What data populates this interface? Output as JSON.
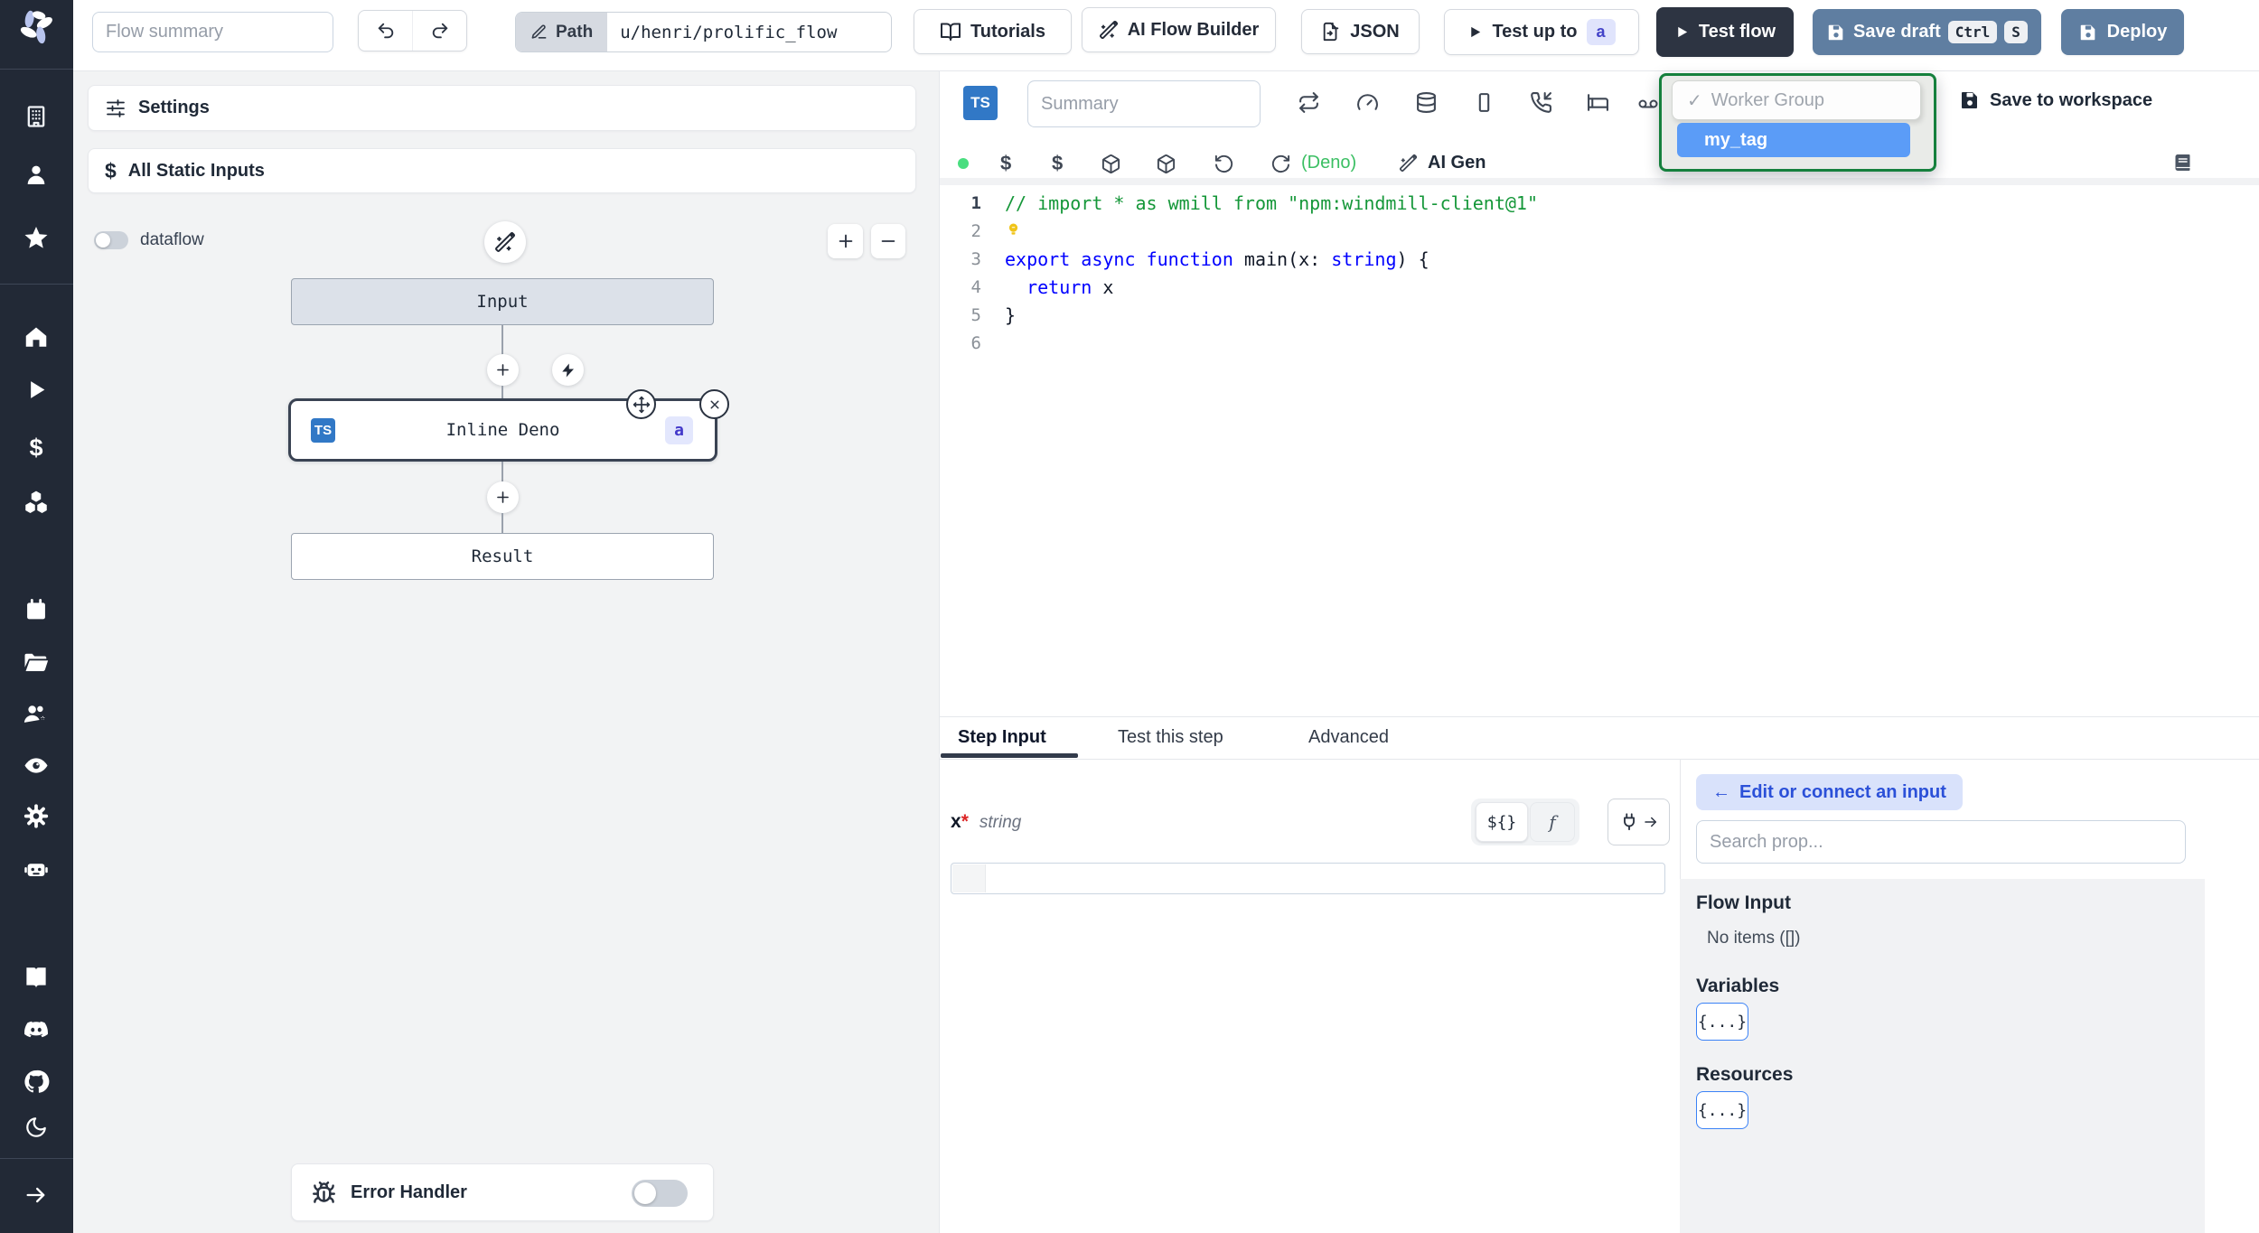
{
  "colors": {
    "sidebar_bg": "#222936",
    "dark_button": "#2d3442",
    "slate_button": "#5f7ea1",
    "ts_badge_blue": "#3178c6",
    "dropdown_outline_green": "#15803d",
    "dropdown_selected_blue": "#5b9cf7",
    "badge_indigo_bg": "#e0e4fc",
    "badge_indigo_text": "#4343c8",
    "status_green": "#4ade80"
  },
  "topbar": {
    "flow_summary_placeholder": "Flow summary",
    "path_button": "Path",
    "path_value": "u/henri/prolific_flow",
    "tutorials": "Tutorials",
    "ai_flow_builder": "AI Flow Builder",
    "json": "JSON",
    "test_up_to": "Test up to",
    "test_up_to_badge": "a",
    "test_flow": "Test flow",
    "save_draft": "Save draft",
    "kbd_ctrl": "Ctrl",
    "kbd_s": "S",
    "deploy": "Deploy"
  },
  "left_panel": {
    "settings": "Settings",
    "all_static_inputs": "All Static Inputs",
    "dataflow": "dataflow",
    "nodes": {
      "input": "Input",
      "step": "Inline Deno",
      "step_lang": "TS",
      "step_id": "a",
      "result": "Result"
    },
    "error_handler": "Error Handler"
  },
  "editor": {
    "lang_badge": "TS",
    "summary_placeholder": "Summary",
    "worker_group": {
      "checkmark": "✓",
      "label": "Worker Group",
      "selected": "my_tag"
    },
    "save_to_workspace": "Save to workspace",
    "runtime": "(Deno)",
    "ai_gen": "AI Gen",
    "code": {
      "lines": [
        {
          "n": "1",
          "segs": [
            {
              "t": "// import * as wmill from \"npm:windmill-client@1\"",
              "c": "cmt"
            }
          ]
        },
        {
          "n": "2",
          "bulb": true,
          "segs": []
        },
        {
          "n": "3",
          "segs": [
            {
              "t": "export",
              "c": "kw"
            },
            {
              "t": " ",
              "c": "pl"
            },
            {
              "t": "async",
              "c": "kw"
            },
            {
              "t": " ",
              "c": "pl"
            },
            {
              "t": "function",
              "c": "kw"
            },
            {
              "t": " main(x: ",
              "c": "pl"
            },
            {
              "t": "string",
              "c": "kw"
            },
            {
              "t": ") {",
              "c": "pl"
            }
          ]
        },
        {
          "n": "4",
          "segs": [
            {
              "t": "  ",
              "c": "pl"
            },
            {
              "t": "return",
              "c": "kw"
            },
            {
              "t": " x",
              "c": "pl"
            }
          ]
        },
        {
          "n": "5",
          "segs": [
            {
              "t": "}",
              "c": "pl"
            }
          ]
        },
        {
          "n": "6",
          "segs": []
        }
      ]
    }
  },
  "bottom": {
    "tabs": [
      "Step Input",
      "Test this step",
      "Advanced"
    ],
    "field": {
      "name": "x",
      "required": "*",
      "type": "string"
    },
    "toggle_expr": "${}",
    "toggle_fn": "f",
    "prop_picker": {
      "back_arrow": "←",
      "edit_connect": "Edit or connect an input",
      "search_placeholder": "Search prop...",
      "flow_input_title": "Flow Input",
      "flow_input_empty": "No items ([])",
      "variables_title": "Variables",
      "variables_chip": "{...}",
      "resources_title": "Resources",
      "resources_chip": "{...}"
    }
  }
}
